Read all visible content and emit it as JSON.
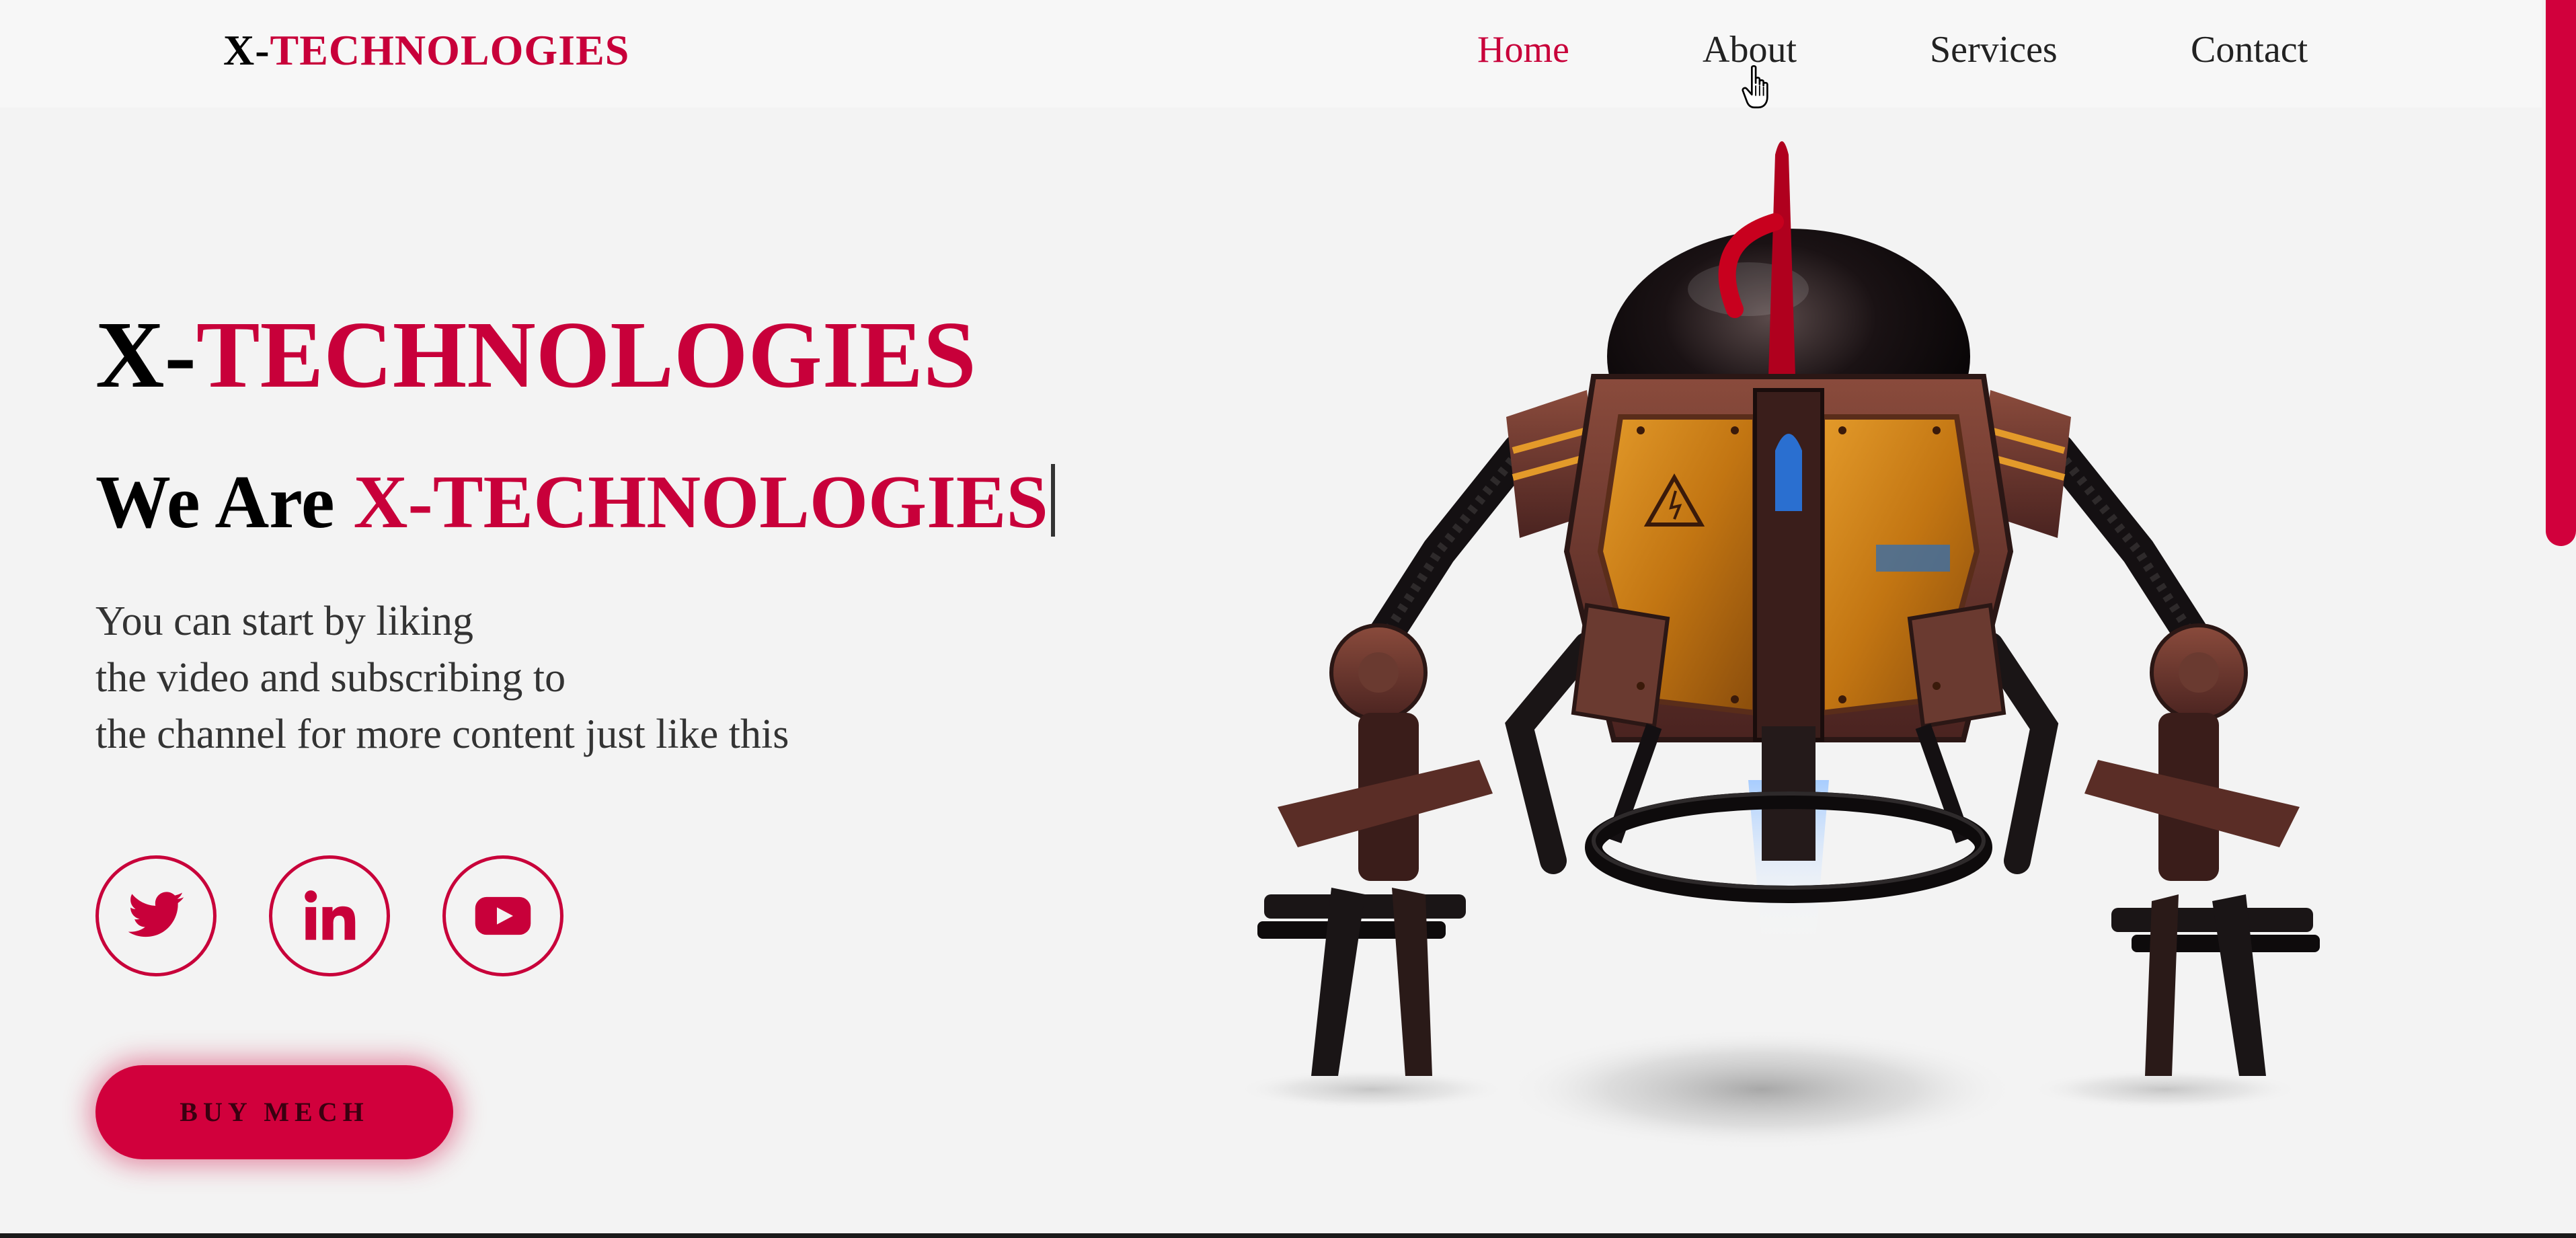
{
  "header": {
    "logo_prefix": "X-",
    "logo_rest": "TECHNOLOGIES",
    "nav": [
      {
        "label": "Home",
        "active": true
      },
      {
        "label": "About",
        "active": false
      },
      {
        "label": "Services",
        "active": false
      },
      {
        "label": "Contact",
        "active": false
      }
    ]
  },
  "hero": {
    "title_prefix": "X-",
    "title_rest": "TECHNOLOGIES",
    "subtitle_lead": "We Are ",
    "subtitle_accent": "X-TECHNOLOGIES",
    "description_lines": [
      "You can start by liking",
      "the video and subscribing to",
      "the channel for more content just like this"
    ],
    "button_label": "BUY MECH"
  },
  "social": [
    {
      "icon": "twitter-icon"
    },
    {
      "icon": "linkedin-icon"
    },
    {
      "icon": "youtube-icon"
    }
  ],
  "colors": {
    "accent": "#c8003a",
    "background": "#f3f3f3",
    "header_background": "#f7f7f7",
    "text": "#000000"
  }
}
